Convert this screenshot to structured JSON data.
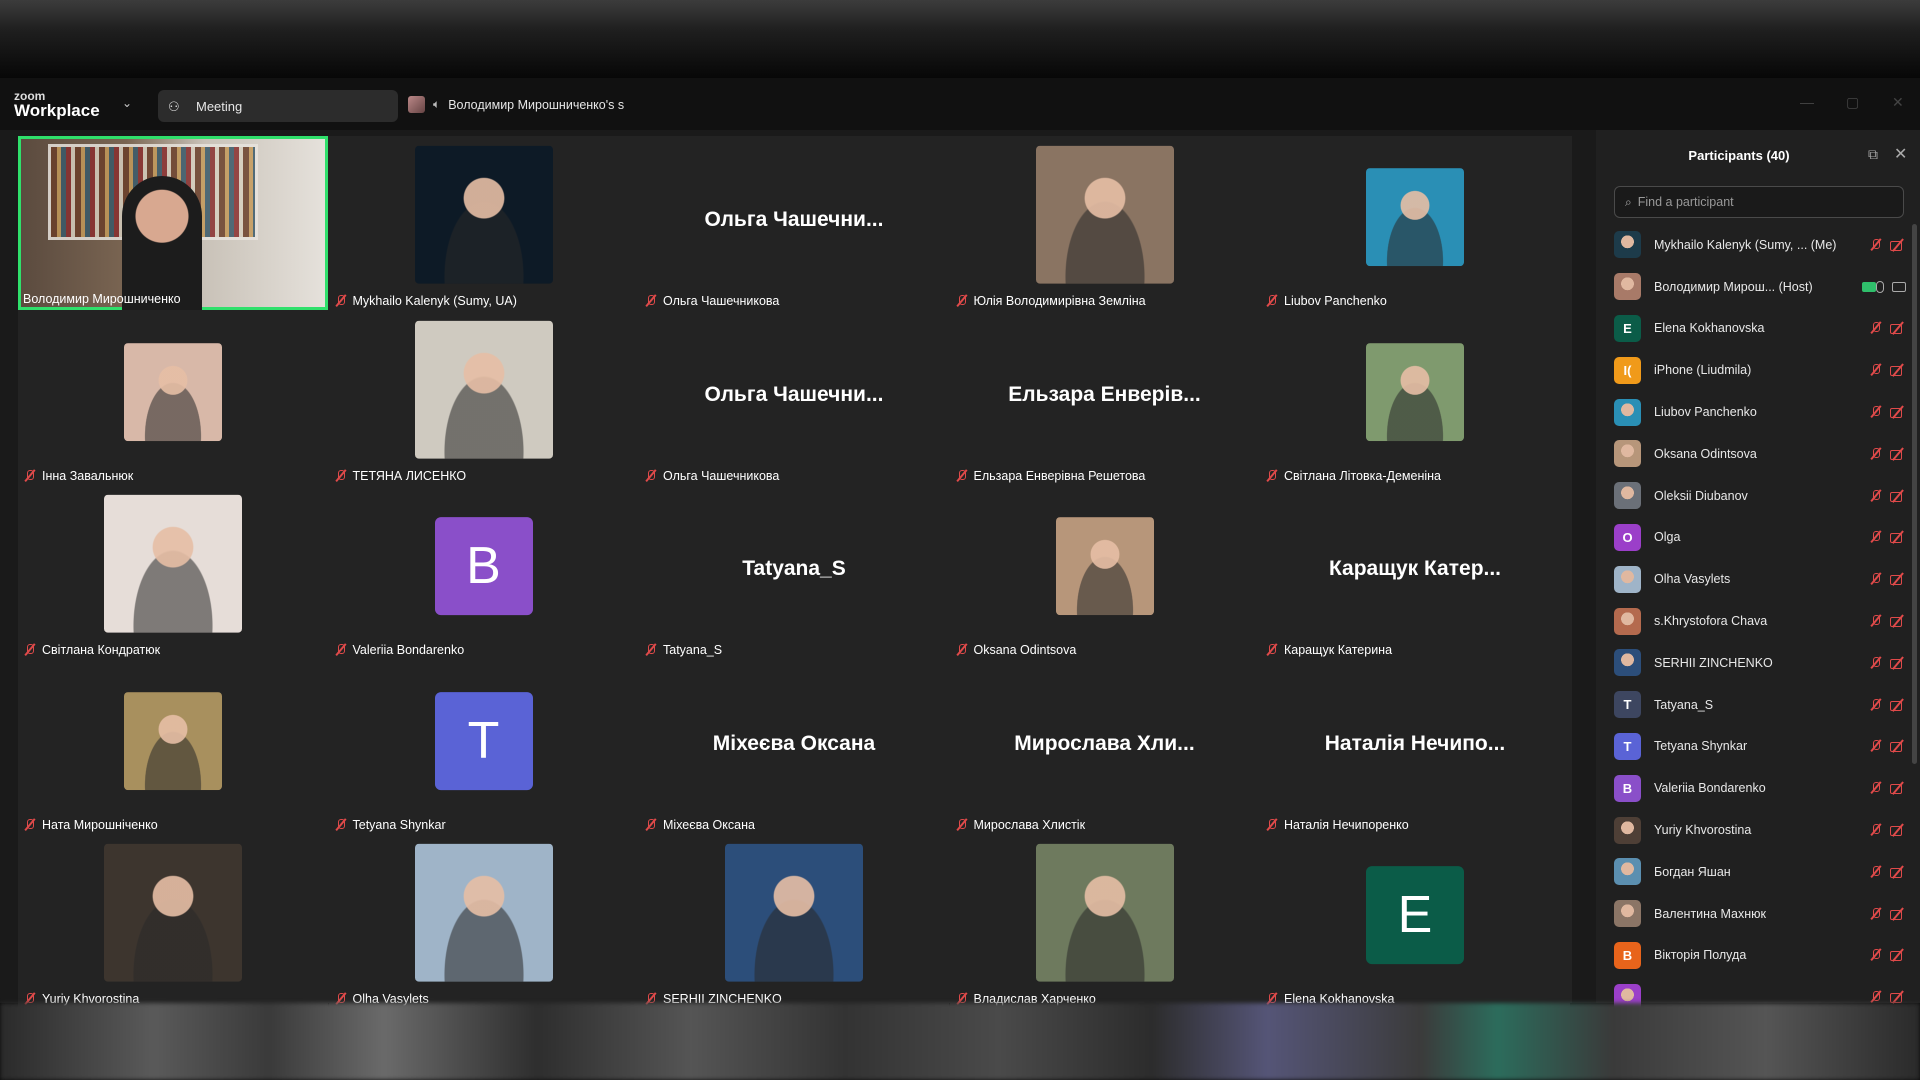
{
  "app": {
    "logo_small": "zoom",
    "logo_big": "Workplace"
  },
  "tabs": {
    "meeting": "Meeting",
    "speaker": "Володимир Мирошниченко's s"
  },
  "tiles": [
    {
      "id": "t0",
      "label": "Володимир Мирошниченко",
      "type": "video",
      "active": true,
      "muted": false,
      "col": 0,
      "row": 0
    },
    {
      "id": "t1",
      "label": "Mykhailo Kalenyk (Sumy, UA)",
      "type": "photo",
      "bg": "#0d1a26",
      "col": 1,
      "row": 0
    },
    {
      "id": "t2",
      "label": "Ольга Чашечникова",
      "type": "text",
      "big": "Ольга  Чашечни...",
      "col": 2,
      "row": 0
    },
    {
      "id": "t3",
      "label": "Юлія Володимирівна Земліна",
      "type": "photo",
      "bg": "#8a7462",
      "col": 3,
      "row": 0
    },
    {
      "id": "t4",
      "label": "Liubov Panchenko",
      "type": "photo-sm",
      "bg": "#2a8fb5",
      "col": 4,
      "row": 0
    },
    {
      "id": "t5",
      "label": "Інна Завальнюк",
      "type": "photo-sm",
      "bg": "#d8b8a8",
      "col": 0,
      "row": 1
    },
    {
      "id": "t6",
      "label": "ТЕТЯНА ЛИСЕНКО",
      "type": "photo",
      "bg": "#cfcac0",
      "col": 1,
      "row": 1
    },
    {
      "id": "t7",
      "label": "Ольга Чашечникова",
      "type": "text",
      "big": "Ольга  Чашечни...",
      "col": 2,
      "row": 1
    },
    {
      "id": "t8",
      "label": "Ельзара Енверівна Решетова",
      "type": "text",
      "big": "Ельзара  Енверів...",
      "col": 3,
      "row": 1
    },
    {
      "id": "t9",
      "label": "Світлана Літовка-Деменіна",
      "type": "photo-sm",
      "bg": "#7f9a6e",
      "col": 4,
      "row": 1
    },
    {
      "id": "t10",
      "label": "Світлана Кондратюк",
      "type": "photo",
      "bg": "#e6ddd8",
      "col": 0,
      "row": 2
    },
    {
      "id": "t11",
      "label": "Valeriia Bondarenko",
      "type": "letter",
      "letter": "B",
      "bg": "#8a4fc9",
      "col": 1,
      "row": 2
    },
    {
      "id": "t12",
      "label": "Tatyana_S",
      "type": "text",
      "big": "Tatyana_S",
      "col": 2,
      "row": 2
    },
    {
      "id": "t13",
      "label": "Oksana Odintsova",
      "type": "photo-sm",
      "bg": "#b7967a",
      "col": 3,
      "row": 2
    },
    {
      "id": "t14",
      "label": "Каращук Катерина",
      "type": "text",
      "big": "Каращук  Катер...",
      "col": 4,
      "row": 2
    },
    {
      "id": "t15",
      "label": "Ната Мирошніченко",
      "type": "photo-sm",
      "bg": "#a8905e",
      "col": 0,
      "row": 3
    },
    {
      "id": "t16",
      "label": "Tetyana Shynkar",
      "type": "letter",
      "letter": "T",
      "bg": "#5a63d6",
      "col": 1,
      "row": 3
    },
    {
      "id": "t17",
      "label": "Міхеєва Оксана",
      "type": "text",
      "big": "Міхеєва Оксана",
      "col": 2,
      "row": 3
    },
    {
      "id": "t18",
      "label": "Мирослава Хлистік",
      "type": "text",
      "big": "Мирослава  Хли...",
      "col": 3,
      "row": 3
    },
    {
      "id": "t19",
      "label": "Наталія Нечипоренко",
      "type": "text",
      "big": "Наталія  Нечипо...",
      "col": 4,
      "row": 3
    },
    {
      "id": "t20",
      "label": "Yuriy Khvorostina",
      "type": "photo",
      "bg": "#3d352e",
      "col": 0,
      "row": 4
    },
    {
      "id": "t21",
      "label": "Olha Vasylets",
      "type": "photo",
      "bg": "#9fb4c8",
      "col": 1,
      "row": 4
    },
    {
      "id": "t22",
      "label": "SERHII ZINCHENKO",
      "type": "photo",
      "bg": "#2c4e7a",
      "col": 2,
      "row": 4
    },
    {
      "id": "t23",
      "label": "Владислав Харченко",
      "type": "photo",
      "bg": "#6e7a5e",
      "col": 3,
      "row": 4
    },
    {
      "id": "t24",
      "label": "Elena Kokhanovska",
      "type": "letter",
      "letter": "E",
      "bg": "#0b5c48",
      "col": 4,
      "row": 4
    }
  ],
  "panel": {
    "title": "Participants (40)",
    "search_placeholder": "Find a participant",
    "participants": [
      {
        "name": "Mykhailo Kalenyk (Sumy, ...  (Me)",
        "av": "",
        "bg": "#1d3b4a",
        "muted": true,
        "video": false
      },
      {
        "name": "Володимир Мирош... (Host)",
        "av": "",
        "bg": "#a87a68",
        "muted": false,
        "video": true,
        "host": true
      },
      {
        "name": "Elena Kokhanovska",
        "av": "E",
        "bg": "#0b5c48",
        "muted": true,
        "video": false
      },
      {
        "name": "iPhone (Liudmila)",
        "av": "I(",
        "bg": "#f09a1a",
        "muted": true,
        "video": false
      },
      {
        "name": "Liubov Panchenko",
        "av": "",
        "bg": "#2a8fb5",
        "muted": true,
        "video": false
      },
      {
        "name": "Oksana Odintsova",
        "av": "",
        "bg": "#b7967a",
        "muted": true,
        "video": false
      },
      {
        "name": "Oleksii Diubanov",
        "av": "",
        "bg": "#6b7078",
        "muted": true,
        "video": false
      },
      {
        "name": "Olga",
        "av": "O",
        "bg": "#9b3fc9",
        "muted": true,
        "video": false
      },
      {
        "name": "Olha Vasylets",
        "av": "",
        "bg": "#9fb4c8",
        "muted": true,
        "video": false
      },
      {
        "name": "s.Khrystofora Chava",
        "av": "",
        "bg": "#b46a4e",
        "muted": true,
        "video": false
      },
      {
        "name": "SERHII ZINCHENKO",
        "av": "",
        "bg": "#2c4e7a",
        "muted": true,
        "video": false
      },
      {
        "name": "Tatyana_S",
        "av": "T",
        "bg": "#3d4660",
        "muted": true,
        "video": false
      },
      {
        "name": "Tetyana Shynkar",
        "av": "T",
        "bg": "#5a63d6",
        "muted": true,
        "video": false
      },
      {
        "name": "Valeriia Bondarenko",
        "av": "B",
        "bg": "#8a4fc9",
        "muted": true,
        "video": false
      },
      {
        "name": "Yuriy Khvorostina",
        "av": "",
        "bg": "#4e3f36",
        "muted": true,
        "video": false
      },
      {
        "name": "Богдан Яшан",
        "av": "",
        "bg": "#5b8fb0",
        "muted": true,
        "video": false
      },
      {
        "name": "Валентина Махнюк",
        "av": "",
        "bg": "#8b7566",
        "muted": true,
        "video": false
      },
      {
        "name": "Вікторія Полуда",
        "av": "В",
        "bg": "#e8641b",
        "muted": true,
        "video": false
      },
      {
        "name": "",
        "av": "",
        "bg": "#9b3fc9",
        "muted": true,
        "video": false
      }
    ]
  }
}
